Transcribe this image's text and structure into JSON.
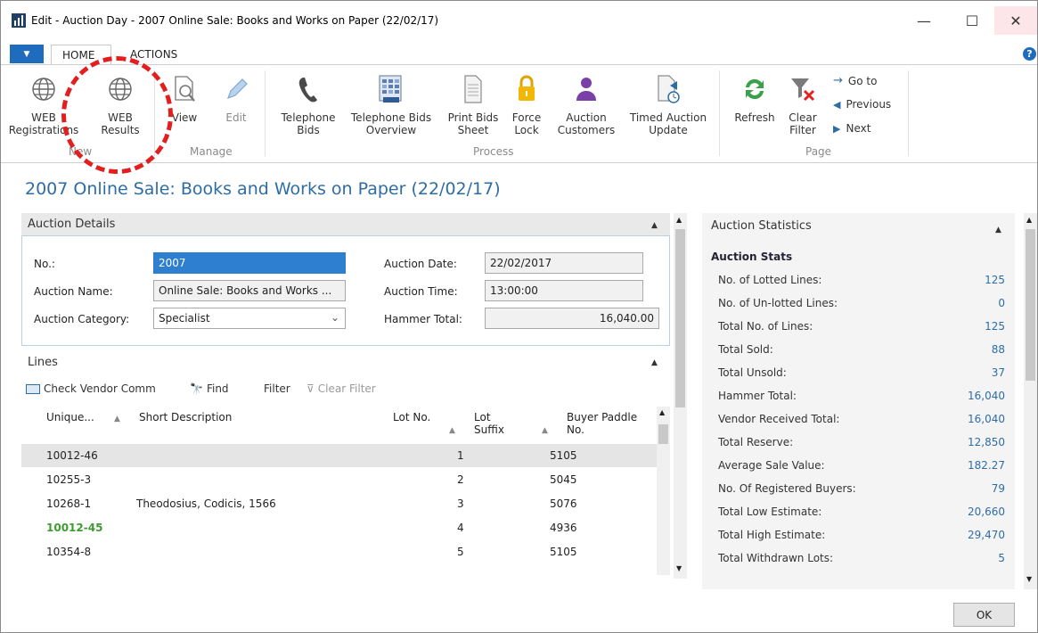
{
  "window": {
    "title": "Edit - Auction Day - 2007 Online Sale: Books and Works on Paper (22/02/17)",
    "minimize": "—",
    "maximize": "☐",
    "close": "✕"
  },
  "ribbon_tabs": {
    "app_menu": "▼",
    "home": "HOME",
    "actions": "ACTIONS",
    "help": "?"
  },
  "ribbon": {
    "new_group": "New",
    "manage_group": "Manage",
    "process_group": "Process",
    "page_group": "Page",
    "web_registrations": [
      "WEB",
      "Registrations"
    ],
    "web_results": [
      "WEB",
      "Results"
    ],
    "view": "View",
    "edit": "Edit",
    "telephone_bids": [
      "Telephone",
      "Bids"
    ],
    "telephone_bids_overview": [
      "Telephone Bids",
      "Overview"
    ],
    "print_bids_sheet": [
      "Print Bids",
      "Sheet"
    ],
    "force_lock": [
      "Force",
      "Lock"
    ],
    "auction_customers": [
      "Auction",
      "Customers"
    ],
    "timed_auction_update": [
      "Timed Auction",
      "Update"
    ],
    "refresh": "Refresh",
    "clear_filter": [
      "Clear",
      "Filter"
    ],
    "go_to": "Go to",
    "previous": "Previous",
    "next": "Next"
  },
  "page_title": "2007 Online Sale: Books and Works on Paper (22/02/17)",
  "auction_details": {
    "header": "Auction Details",
    "no_label": "No.:",
    "no_value": "2007",
    "name_label": "Auction Name:",
    "name_value": "Online Sale: Books and Works ...",
    "category_label": "Auction Category:",
    "category_value": "Specialist",
    "date_label": "Auction Date:",
    "date_value": "22/02/2017",
    "time_label": "Auction Time:",
    "time_value": "13:00:00",
    "hammer_label": "Hammer Total:",
    "hammer_value": "16,040.00"
  },
  "lines": {
    "header": "Lines",
    "check_vendor_comm": "Check Vendor Comm",
    "find": "Find",
    "filter": "Filter",
    "clear_filter": "Clear Filter",
    "columns": {
      "unique": "Unique...",
      "short_description": "Short Description",
      "lot_no": "Lot No.",
      "lot_suffix": [
        "Lot",
        "Suffix"
      ],
      "buyer_paddle": [
        "Buyer Paddle",
        "No."
      ]
    },
    "rows": [
      {
        "unique": "10012-46",
        "desc": "",
        "lot": "1",
        "paddle": "5105"
      },
      {
        "unique": "10255-3",
        "desc": "",
        "lot": "2",
        "paddle": "5045"
      },
      {
        "unique": "10268-1",
        "desc": "Theodosius, Codicis, 1566",
        "lot": "3",
        "paddle": "5076"
      },
      {
        "unique": "10012-45",
        "desc": "",
        "lot": "4",
        "paddle": "4936"
      },
      {
        "unique": "10354-8",
        "desc": "",
        "lot": "5",
        "paddle": "5105"
      }
    ]
  },
  "stats": {
    "header": "Auction Statistics",
    "subheader": "Auction Stats",
    "rows": [
      {
        "label": "No. of Lotted Lines:",
        "value": "125"
      },
      {
        "label": "No. of Un-lotted Lines:",
        "value": "0"
      },
      {
        "label": "Total No. of Lines:",
        "value": "125"
      },
      {
        "label": "Total Sold:",
        "value": "88"
      },
      {
        "label": "Total Unsold:",
        "value": "37"
      },
      {
        "label": "Hammer Total:",
        "value": "16,040"
      },
      {
        "label": "Vendor Received Total:",
        "value": "16,040"
      },
      {
        "label": "Total Reserve:",
        "value": "12,850"
      },
      {
        "label": "Average Sale Value:",
        "value": "182.27"
      },
      {
        "label": "No. Of Registered Buyers:",
        "value": "79"
      },
      {
        "label": "Total Low Estimate:",
        "value": "20,660"
      },
      {
        "label": "Total High Estimate:",
        "value": "29,470"
      },
      {
        "label": "Total Withdrawn Lots:",
        "value": "5"
      }
    ]
  },
  "ok_button": "OK",
  "colors": {
    "accent": "#1f6bbd",
    "title_blue": "#2e6da4",
    "highlight_green": "#3d9b2f",
    "annotation_red": "#e21e1e"
  }
}
